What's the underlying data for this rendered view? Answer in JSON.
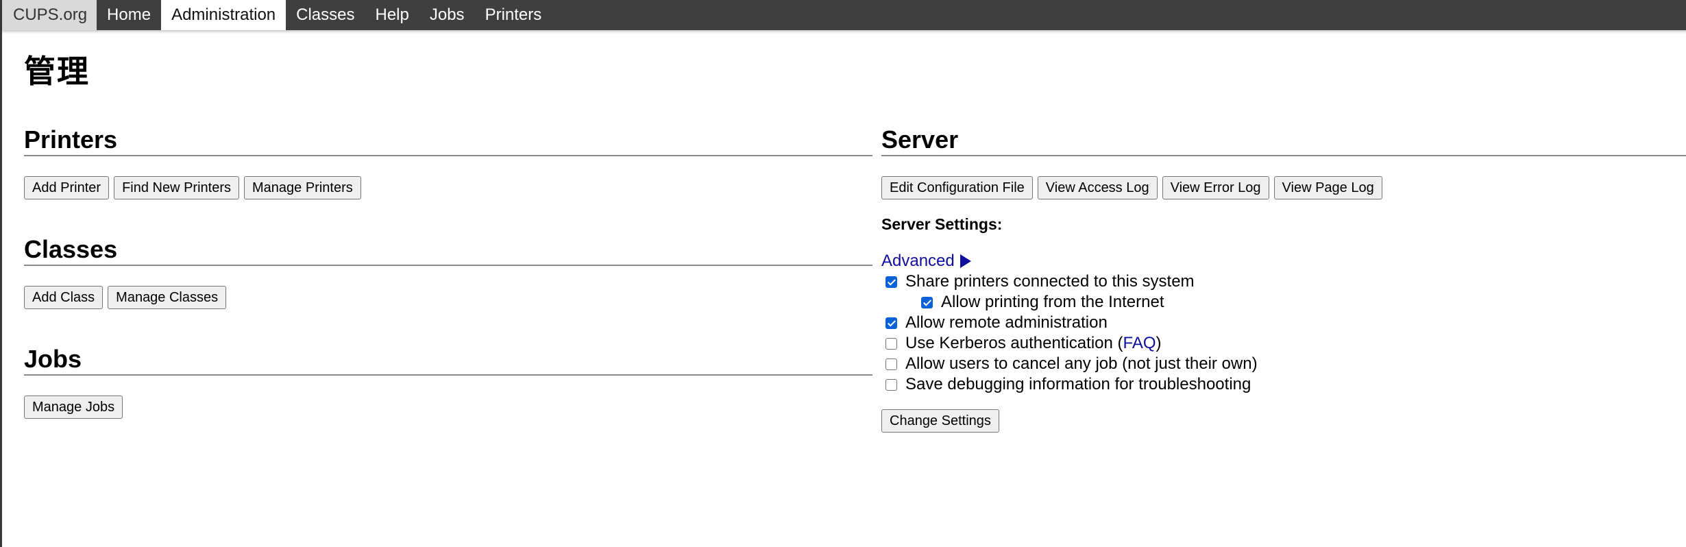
{
  "nav": {
    "brand": "CUPS.org",
    "items": [
      {
        "label": "Home",
        "active": false
      },
      {
        "label": "Administration",
        "active": true
      },
      {
        "label": "Classes",
        "active": false
      },
      {
        "label": "Help",
        "active": false
      },
      {
        "label": "Jobs",
        "active": false
      },
      {
        "label": "Printers",
        "active": false
      }
    ]
  },
  "page": {
    "title": "管理"
  },
  "printers": {
    "heading": "Printers",
    "buttons": [
      "Add Printer",
      "Find New Printers",
      "Manage Printers"
    ]
  },
  "classes": {
    "heading": "Classes",
    "buttons": [
      "Add Class",
      "Manage Classes"
    ]
  },
  "jobs": {
    "heading": "Jobs",
    "buttons": [
      "Manage Jobs"
    ]
  },
  "server": {
    "heading": "Server",
    "buttons": [
      "Edit Configuration File",
      "View Access Log",
      "View Error Log",
      "View Page Log"
    ],
    "settings_label": "Server Settings:",
    "advanced_label": "Advanced",
    "options": [
      {
        "label": "Share printers connected to this system",
        "checked": true
      },
      {
        "label": "Allow printing from the Internet",
        "checked": true
      },
      {
        "label": "Allow remote administration",
        "checked": true
      },
      {
        "label_before": "Use Kerberos authentication (",
        "link": "FAQ",
        "label_after": ")",
        "checked": false
      },
      {
        "label": "Allow users to cancel any job (not just their own)",
        "checked": false
      },
      {
        "label": "Save debugging information for troubleshooting",
        "checked": false
      }
    ],
    "change_button": "Change Settings"
  },
  "colors": {
    "navbar_bg": "#3f3f3f",
    "link": "#0f0f9e",
    "checkbox_checked": "#0b62d6"
  }
}
